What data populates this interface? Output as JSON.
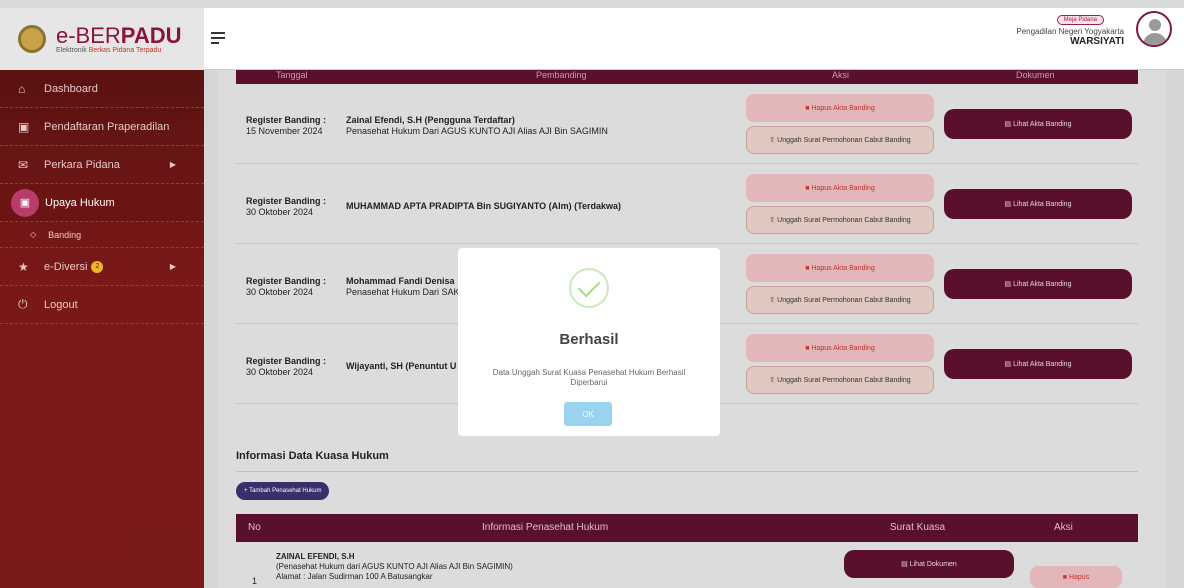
{
  "brand": {
    "title_bold": "e-BER",
    "title_accent": "PADU",
    "subtitle_pre": "Elektronik ",
    "subtitle_red": "Berkas Pidana Terpadu"
  },
  "user": {
    "desk": "Meja Pidana",
    "court": "Pengadilan Negeri Yogyakarta",
    "name": "WARSIYATI"
  },
  "sidebar": {
    "items": [
      {
        "label": "Dashboard",
        "icon": "home-icon"
      },
      {
        "label": "Pendaftaran Praperadilan",
        "icon": "book-icon"
      },
      {
        "label": "Perkara Pidana",
        "icon": "folder-icon"
      },
      {
        "label": "Upaya Hukum",
        "icon": "book-icon"
      },
      {
        "label": "Banding",
        "icon": "diamond-icon"
      },
      {
        "label": "e-Diversi",
        "icon": "star-icon",
        "badge": "2"
      },
      {
        "label": "Logout",
        "icon": "power-icon"
      }
    ]
  },
  "table_header": {
    "col1": "Tanggal",
    "col2": "Pembanding",
    "col3": "Aksi",
    "col4": "Dokumen"
  },
  "rows": [
    {
      "label": "Register Banding :",
      "date": "15 November 2024",
      "party": "Zainal Efendi, S.H (Pengguna Terdaftar)",
      "party_sub": "Penasehat Hukum Dari AGUS KUNTO AJI Alias AJI Bin SAGIMIN"
    },
    {
      "label": "Register Banding :",
      "date": "30 Oktober 2024",
      "party": "MUHAMMAD APTA PRADIPTA Bin SUGIYANTO (Alm) (Terdakwa)",
      "party_sub": ""
    },
    {
      "label": "Register Banding :",
      "date": "30 Oktober 2024",
      "party": "Mohammad Fandi Denisa",
      "party_sub": "Penasehat Hukum Dari SAK"
    },
    {
      "label": "Register Banding :",
      "date": "30 Oktober 2024",
      "party": "Wijayanti, SH (Penuntut U",
      "party_sub": ""
    }
  ],
  "buttons": {
    "hapus_akta": "Hapus Akta Banding",
    "unggah": "Unggah Surat Permohonan Cabut Banding",
    "lihat_akta": "Lihat Akta Banding"
  },
  "kuasa": {
    "title": "Informasi Data Kuasa Hukum",
    "add_button": "+ Tambah Penasehat Hukum",
    "headers": {
      "no": "No",
      "info": "Informasi Penasehat Hukum",
      "surat": "Surat Kuasa",
      "aksi": "Aksi"
    },
    "rows": [
      {
        "no": "1",
        "name": "ZAINAL EFENDI, S.H",
        "sub": "(Penasehat Hukum dari AGUS KUNTO AJI Alias AJI Bin SAGIMIN)",
        "address": "Alamat : Jalan Sudirman 100 A Batusangkar",
        "doc_button": "Lihat Dokumen",
        "delete_button": "Hapus"
      }
    ]
  },
  "modal": {
    "title": "Berhasil",
    "message": "Data Unggah Surat Kuasa Penasehat Hukum Berhasil Diperbarui",
    "ok": "OK"
  }
}
